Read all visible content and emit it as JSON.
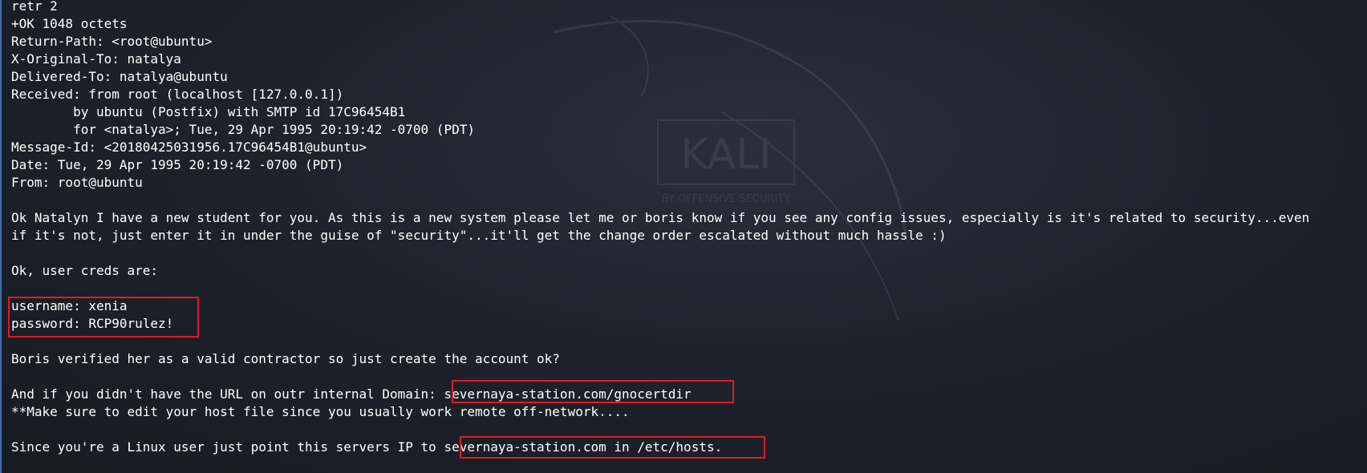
{
  "terminal": {
    "lines": [
      "retr 2",
      "+OK 1048 octets",
      "Return-Path: <root@ubuntu>",
      "X-Original-To: natalya",
      "Delivered-To: natalya@ubuntu",
      "Received: from root (localhost [127.0.0.1])",
      "        by ubuntu (Postfix) with SMTP id 17C96454B1",
      "        for <natalya>; Tue, 29 Apr 1995 20:19:42 -0700 (PDT)",
      "Message-Id: <20180425031956.17C96454B1@ubuntu>",
      "Date: Tue, 29 Apr 1995 20:19:42 -0700 (PDT)",
      "From: root@ubuntu",
      "",
      "Ok Natalyn I have a new student for you. As this is a new system please let me or boris know if you see any config issues, especially is it's related to security...even",
      "if it's not, just enter it in under the guise of \"security\"...it'll get the change order escalated without much hassle :)",
      "",
      "Ok, user creds are:",
      "",
      "username: xenia",
      "password: RCP90rulez!",
      "",
      "Boris verified her as a valid contractor so just create the account ok?",
      "",
      "And if you didn't have the URL on outr internal Domain: severnaya-station.com/gnocertdir",
      "**Make sure to edit your host file since you usually work remote off-network....",
      "",
      "Since you're a Linux user just point this servers IP to severnaya-station.com in /etc/hosts."
    ]
  },
  "watermark": {
    "text": "KALI",
    "subtext": "BY OFFENSIVE SECURITY"
  },
  "colors": {
    "text": "#ffffff",
    "highlight_border": "#e01b24",
    "background": "#1e222b"
  }
}
